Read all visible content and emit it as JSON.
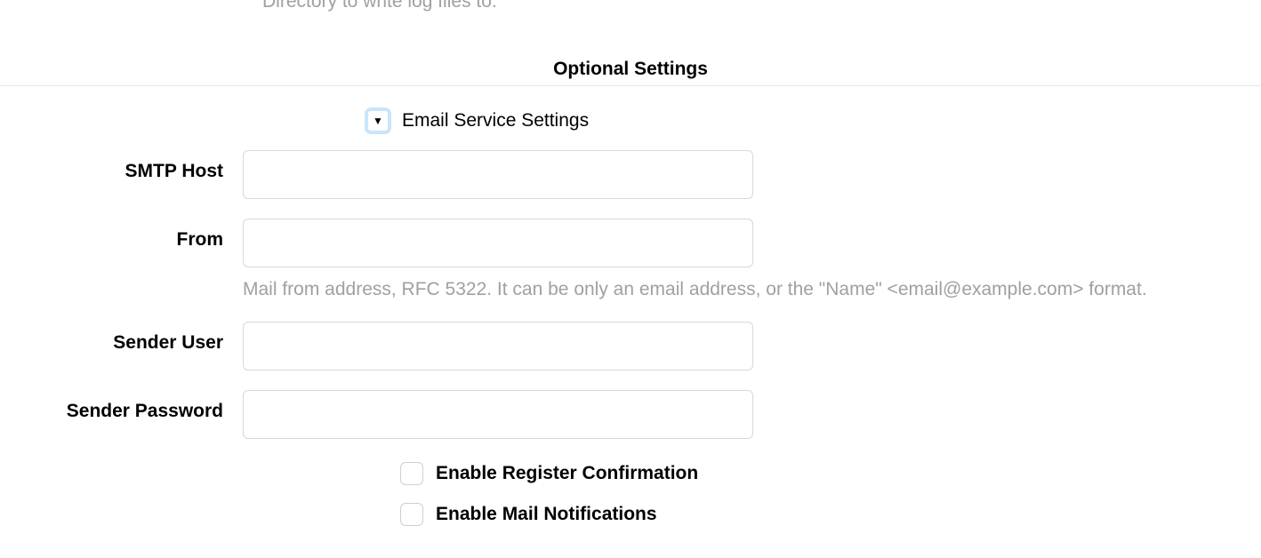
{
  "partial_help_text": "Directory to write log files to.",
  "section_title": "Optional Settings",
  "details": {
    "title": "Email Service Settings"
  },
  "fields": {
    "smtp_host": {
      "label": "SMTP Host",
      "value": ""
    },
    "from": {
      "label": "From",
      "value": "",
      "help": "Mail from address, RFC 5322. It can be only an email address, or the \"Name\" <email@example.com> format."
    },
    "sender_user": {
      "label": "Sender User",
      "value": ""
    },
    "sender_password": {
      "label": "Sender Password",
      "value": ""
    }
  },
  "checkboxes": {
    "enable_register_confirmation": {
      "label": "Enable Register Confirmation",
      "checked": false
    },
    "enable_mail_notifications": {
      "label": "Enable Mail Notifications",
      "checked": false
    }
  }
}
